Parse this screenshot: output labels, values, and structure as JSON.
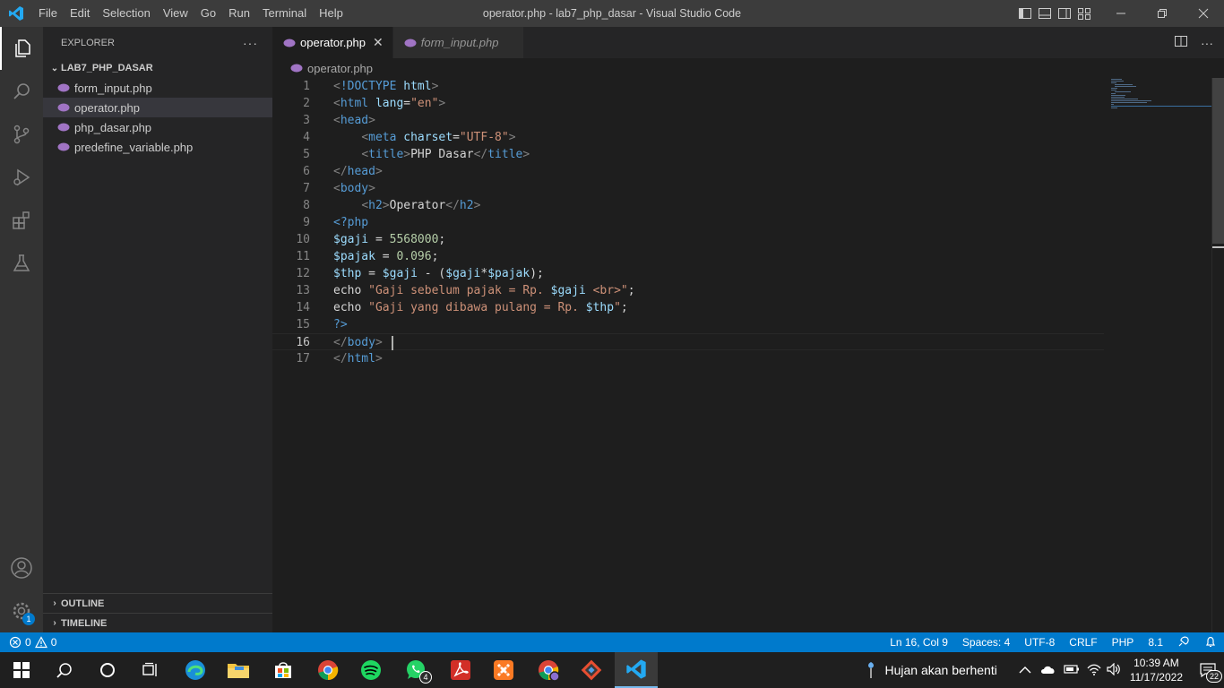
{
  "window": {
    "title": "operator.php - lab7_php_dasar - Visual Studio Code"
  },
  "menu": [
    "File",
    "Edit",
    "Selection",
    "View",
    "Go",
    "Run",
    "Terminal",
    "Help"
  ],
  "sidebar": {
    "header": "EXPLORER",
    "folder": "LAB7_PHP_DASAR",
    "files": [
      "form_input.php",
      "operator.php",
      "php_dasar.php",
      "predefine_variable.php"
    ],
    "outline": "OUTLINE",
    "timeline": "TIMELINE"
  },
  "activity": {
    "settings_badge": "1"
  },
  "tabs": [
    {
      "label": "operator.php"
    },
    {
      "label": "form_input.php"
    }
  ],
  "breadcrumb": "operator.php",
  "editor": {
    "current_line": 16,
    "lines": [
      "1",
      "2",
      "3",
      "4",
      "5",
      "6",
      "7",
      "8",
      "9",
      "10",
      "11",
      "12",
      "13",
      "14",
      "15",
      "16",
      "17"
    ]
  },
  "status": {
    "errors": "0",
    "warnings": "0",
    "position": "Ln 16, Col 9",
    "spaces": "Spaces: 4",
    "encoding": "UTF-8",
    "eol": "CRLF",
    "language": "PHP",
    "php_version": "8.1"
  },
  "taskbar": {
    "whatsapp_badge": "4",
    "weather": "Hujan akan berhenti",
    "time": "10:39 AM",
    "date": "11/17/2022",
    "notifications": "22"
  },
  "colors": {
    "accent": "#007acc",
    "tag": "#569cd6",
    "attr": "#9cdcfe",
    "string": "#ce9178",
    "number": "#b5cea8",
    "punct": "#808080"
  }
}
